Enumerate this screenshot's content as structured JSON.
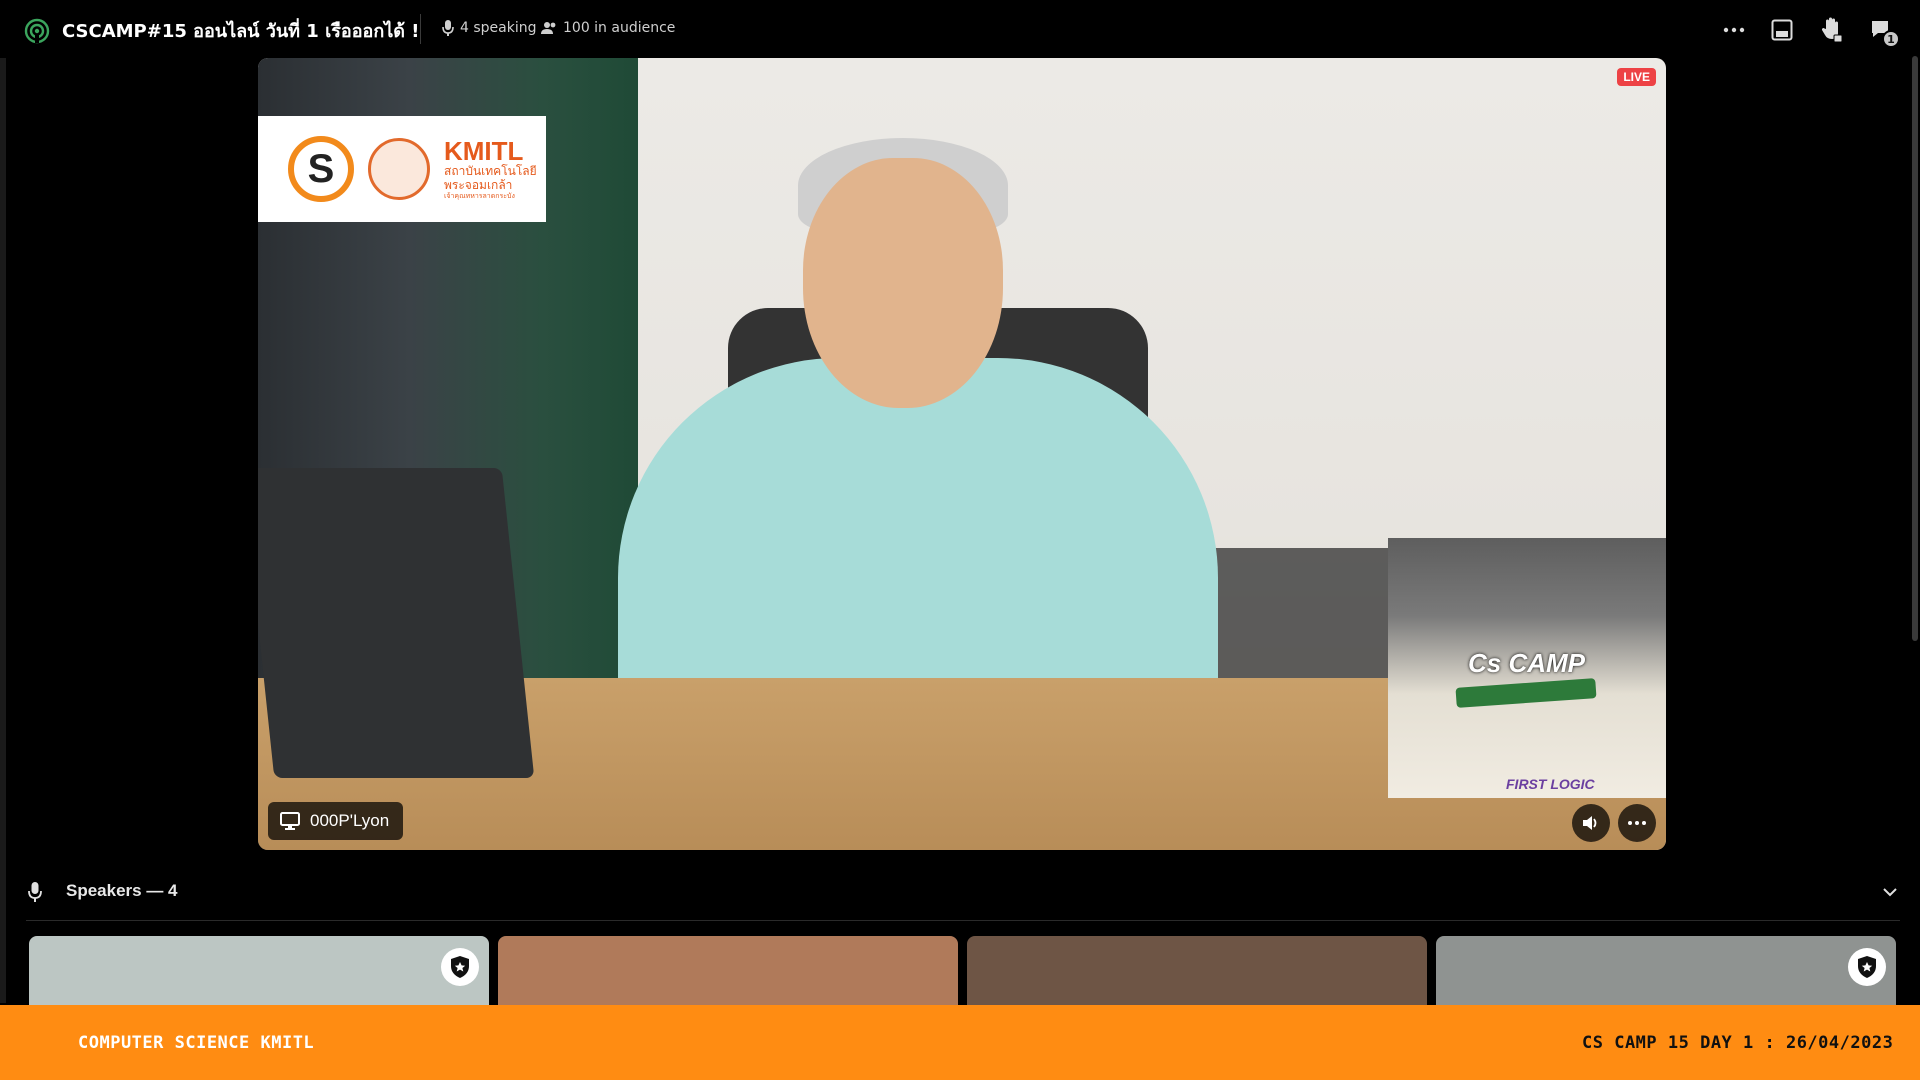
{
  "header": {
    "title": "CSCAMP#15 ออนไลน์ วันที่ 1 เรือออกได้ !",
    "speaking_count": "4 speaking",
    "audience_count": "100 in audience",
    "inbox_badge": "1",
    "icons": [
      "stage-channel-icon",
      "microphone-icon",
      "people-icon",
      "more-options-icon",
      "popout-icon",
      "raise-hand-icon",
      "inbox-icon"
    ]
  },
  "video": {
    "live_label": "LIVE",
    "streamer_name": "000P'Lyon",
    "logo_s": "S",
    "logo_kmitl_title": "KMITL",
    "logo_kmitl_line1": "สถาบันเทคโนโลยี",
    "logo_kmitl_line2": "พระจอมเกล้า",
    "logo_kmitl_line3": "เจ้าคุณทหารลาดกระบัง",
    "watermark_cs": "Cs CAMP",
    "watermark_firstlogic": "FIRST LOGIC"
  },
  "speakers": {
    "label": "Speakers — 4",
    "tiles": [
      {
        "color": "#bcc6c3",
        "moderator": true
      },
      {
        "color": "#b07a5a",
        "moderator": false
      },
      {
        "color": "#6e5545",
        "moderator": false
      },
      {
        "color": "#8f9391",
        "moderator": true
      }
    ]
  },
  "footer": {
    "left_text": "COMPUTER SCIENCE KMITL",
    "right_text": "CS CAMP 15 DAY 1 : 26/04/2023",
    "color": "#ff8c12"
  }
}
